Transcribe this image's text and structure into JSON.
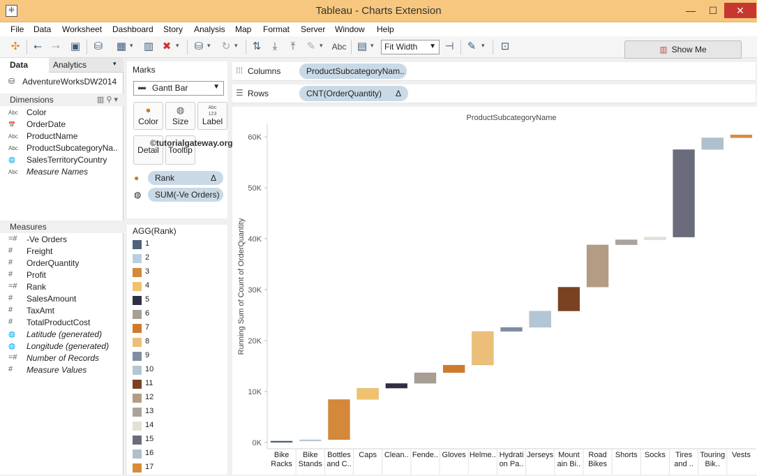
{
  "window": {
    "title": "Tableau - Charts Extension",
    "minimize": "—",
    "maximize": "☐",
    "close": "✕"
  },
  "menu": [
    "File",
    "Data",
    "Worksheet",
    "Dashboard",
    "Story",
    "Analysis",
    "Map",
    "Format",
    "Server",
    "Window",
    "Help"
  ],
  "toolbar": {
    "abc_label": "Abc",
    "fit_value": "Fit Width",
    "show_me": "Show Me"
  },
  "left_panel": {
    "tabs": [
      "Data",
      "Analytics"
    ],
    "data_source": "AdventureWorksDW2014",
    "dimensions_header": "Dimensions",
    "dimensions": [
      {
        "icon": "Abc",
        "label": "Color"
      },
      {
        "icon": "📅",
        "label": "OrderDate"
      },
      {
        "icon": "Abc",
        "label": "ProductName"
      },
      {
        "icon": "Abc",
        "label": "ProductSubcategoryNa.."
      },
      {
        "icon": "🌐",
        "label": "SalesTerritoryCountry"
      },
      {
        "icon": "Abc",
        "label": "Measure Names",
        "italic": true
      }
    ],
    "measures_header": "Measures",
    "measures": [
      {
        "icon": "=#",
        "label": "-Ve Orders"
      },
      {
        "icon": "#",
        "label": "Freight"
      },
      {
        "icon": "#",
        "label": "OrderQuantity"
      },
      {
        "icon": "#",
        "label": "Profit"
      },
      {
        "icon": "=#",
        "label": "Rank"
      },
      {
        "icon": "#",
        "label": "SalesAmount"
      },
      {
        "icon": "#",
        "label": "TaxAmt"
      },
      {
        "icon": "#",
        "label": "TotalProductCost"
      },
      {
        "icon": "🌐",
        "label": "Latitude (generated)",
        "italic": true
      },
      {
        "icon": "🌐",
        "label": "Longitude (generated)",
        "italic": true
      },
      {
        "icon": "=#",
        "label": "Number of Records",
        "italic": true
      },
      {
        "icon": "#",
        "label": "Measure Values",
        "italic": true
      }
    ]
  },
  "marks": {
    "title": "Marks",
    "type": "Gantt Bar",
    "buttons": {
      "color": "Color",
      "size": "Size",
      "label": "Label",
      "detail": "Detail",
      "tooltip": "Tooltip",
      "label_icon": "Abc\n123"
    },
    "pills": [
      {
        "label": "Rank",
        "delta": "Δ"
      },
      {
        "label": "SUM(-Ve Orders)"
      }
    ]
  },
  "legend": {
    "title": "AGG(Rank)",
    "items": [
      {
        "label": "1",
        "color": "#4e6379"
      },
      {
        "label": "2",
        "color": "#b9cfe1"
      },
      {
        "label": "3",
        "color": "#d4883a"
      },
      {
        "label": "4",
        "color": "#f0c26e"
      },
      {
        "label": "5",
        "color": "#2f2f44"
      },
      {
        "label": "6",
        "color": "#a79e95"
      },
      {
        "label": "7",
        "color": "#d07a2a"
      },
      {
        "label": "8",
        "color": "#ebbf7a"
      },
      {
        "label": "9",
        "color": "#7f8ea3"
      },
      {
        "label": "10",
        "color": "#b3c6d6"
      },
      {
        "label": "11",
        "color": "#7a4220"
      },
      {
        "label": "12",
        "color": "#b49c84"
      },
      {
        "label": "13",
        "color": "#aaa39c"
      },
      {
        "label": "14",
        "color": "#e4e0d6"
      },
      {
        "label": "15",
        "color": "#6b6c7b"
      },
      {
        "label": "16",
        "color": "#b0bfcc"
      },
      {
        "label": "17",
        "color": "#d98c3a"
      }
    ]
  },
  "shelves": {
    "columns_label": "Columns",
    "columns_pill": "ProductSubcategoryNam..",
    "rows_label": "Rows",
    "rows_pill": "CNT(OrderQuantity)",
    "rows_delta": "Δ"
  },
  "chart_data": {
    "type": "bar",
    "subtype": "gantt-waterfall",
    "title": "ProductSubcategoryName",
    "watermark": "©tutorialgateway.org",
    "ylabel": "Running Sum of Count of OrderQuantity",
    "ylim": [
      0,
      65000
    ],
    "yticks": [
      0,
      10000,
      20000,
      30000,
      40000,
      50000,
      60000
    ],
    "ytick_labels": [
      "0K",
      "10K",
      "20K",
      "30K",
      "40K",
      "50K",
      "60K"
    ],
    "categories": [
      "Bike Racks",
      "Bike Stands",
      "Bottles and C..",
      "Caps",
      "Clean..",
      "Fende..",
      "Gloves",
      "Helme..",
      "Hydrati on Pa..",
      "Jerseys",
      "Mount ain Bi..",
      "Road Bikes",
      "Shorts",
      "Socks",
      "Tires and ..",
      "Touring Bik..",
      "Vests"
    ],
    "starts": [
      0,
      300,
      550,
      8450,
      10650,
      11600,
      13700,
      15200,
      21800,
      22600,
      25800,
      30500,
      38800,
      39800,
      40300,
      57500,
      59800
    ],
    "ends": [
      300,
      550,
      8450,
      10650,
      11600,
      13700,
      15200,
      21800,
      22600,
      25800,
      30500,
      38800,
      39800,
      40300,
      57500,
      59800,
      60400
    ],
    "colors": [
      "#4e6379",
      "#b9cfe1",
      "#d4883a",
      "#f0c26e",
      "#2f2f44",
      "#a79e95",
      "#d07a2a",
      "#ebbf7a",
      "#7f8ea3",
      "#b3c6d6",
      "#7a4220",
      "#b49c84",
      "#aaa39c",
      "#e4e0d6",
      "#6b6c7b",
      "#b0bfcc",
      "#d98c3a"
    ],
    "grid": false
  }
}
